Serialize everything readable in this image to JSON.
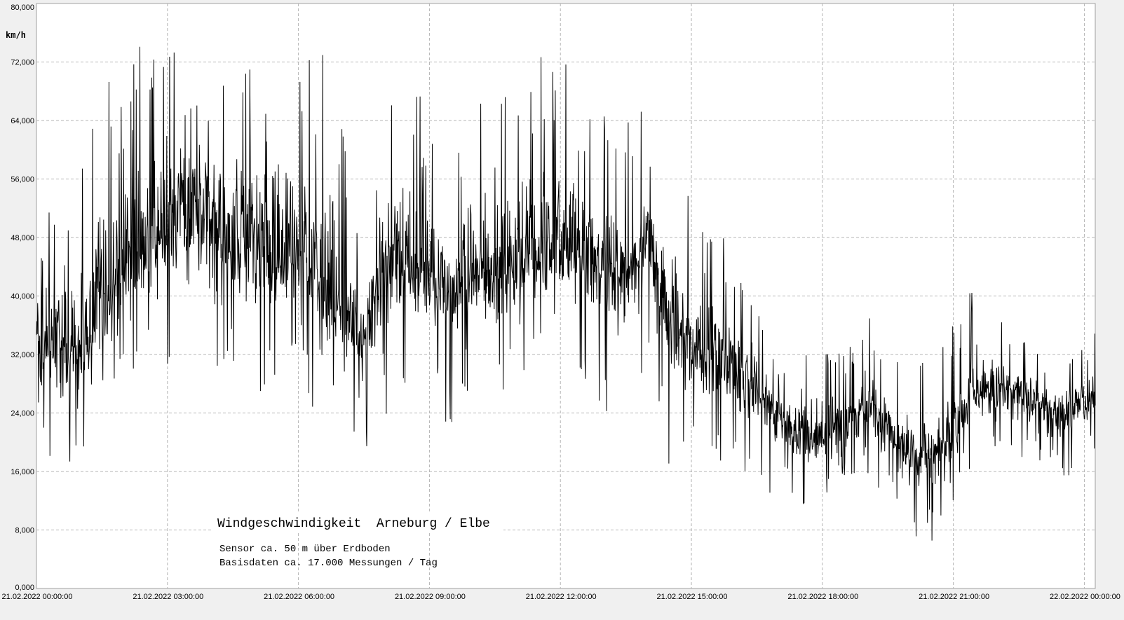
{
  "chart_data": {
    "type": "line",
    "ylabel": "km/h",
    "ylim": [
      0,
      80
    ],
    "y_ticks": [
      "0,000",
      "8,000",
      "16,000",
      "24,000",
      "32,000",
      "40,000",
      "48,000",
      "56,000",
      "64,000",
      "72,000",
      "80,000"
    ],
    "x_ticks": [
      "21.02.2022  00:00:00",
      "21.02.2022  03:00:00",
      "21.02.2022  06:00:00",
      "21.02.2022  09:00:00",
      "21.02.2022  12:00:00",
      "21.02.2022  15:00:00",
      "21.02.2022  18:00:00",
      "21.02.2022  21:00:00",
      "22.02.2022  00:00:00"
    ],
    "x_range": [
      "21.02.2022 00:00",
      "22.02.2022 00:15"
    ],
    "grid": true,
    "annotation": {
      "title": "Windgeschwindigkeit  Arneburg / Elbe",
      "line1": "Sensor ca. 50 m über Erdboden",
      "line2": "Basisdaten ca. 17.000 Messungen / Tag"
    },
    "series": [
      {
        "x": [
          "21.02.2022 00:00",
          "21.02.2022 00:30",
          "21.02.2022 01:00",
          "21.02.2022 01:30",
          "21.02.2022 02:00",
          "21.02.2022 02:30",
          "21.02.2022 03:00",
          "21.02.2022 03:30",
          "21.02.2022 04:00",
          "21.02.2022 04:30",
          "21.02.2022 05:00",
          "21.02.2022 05:30",
          "21.02.2022 06:00",
          "21.02.2022 06:30",
          "21.02.2022 07:00",
          "21.02.2022 07:30",
          "21.02.2022 08:00",
          "21.02.2022 08:30",
          "21.02.2022 09:00",
          "21.02.2022 09:30",
          "21.02.2022 10:00",
          "21.02.2022 10:30",
          "21.02.2022 11:00",
          "21.02.2022 11:30",
          "21.02.2022 12:00",
          "21.02.2022 12:30",
          "21.02.2022 13:00",
          "21.02.2022 13:30",
          "21.02.2022 14:00",
          "21.02.2022 14:30",
          "21.02.2022 15:00",
          "21.02.2022 15:30",
          "21.02.2022 16:00",
          "21.02.2022 16:30",
          "21.02.2022 17:00",
          "21.02.2022 17:30",
          "21.02.2022 18:00",
          "21.02.2022 18:30",
          "21.02.2022 19:00",
          "21.02.2022 19:30",
          "21.02.2022 20:00",
          "21.02.2022 20:30",
          "21.02.2022 21:00",
          "21.02.2022 21:30",
          "21.02.2022 22:00",
          "21.02.2022 22:30",
          "21.02.2022 23:00",
          "21.02.2022 23:30",
          "22.02.2022 00:00",
          "22.02.2022 00:15"
        ],
        "mean": [
          34,
          34,
          33,
          38,
          44,
          46,
          50,
          52,
          49,
          46,
          47,
          45,
          48,
          42,
          38,
          34,
          44,
          43,
          41,
          42,
          43,
          43,
          45,
          46,
          47,
          46,
          45,
          43,
          47,
          38,
          30,
          32,
          30,
          28,
          24,
          20,
          21,
          23,
          25,
          22,
          18,
          19,
          21,
          28,
          27,
          27,
          25,
          24,
          26,
          26
        ],
        "min": [
          19,
          15,
          18,
          25,
          25,
          30,
          24,
          27,
          25,
          30,
          26,
          29,
          30,
          19,
          22,
          19,
          21,
          29,
          28,
          21,
          28,
          25,
          30,
          28,
          31,
          28,
          23,
          24,
          30,
          16,
          17,
          17,
          16,
          13,
          13,
          10,
          12,
          13,
          14,
          12,
          8,
          5,
          11,
          18,
          17,
          18,
          16,
          14,
          16,
          17
        ],
        "max": [
          48,
          56,
          57,
          72,
          67,
          80,
          80,
          80,
          73,
          73,
          80,
          80,
          80,
          75,
          67,
          47,
          69,
          71,
          66,
          62,
          68,
          69,
          74,
          75,
          75,
          69,
          69,
          65,
          67,
          62,
          54,
          50,
          46,
          40,
          30,
          32,
          36,
          32,
          38,
          32,
          30,
          32,
          38,
          42,
          38,
          35,
          33,
          31,
          34,
          35
        ]
      }
    ]
  }
}
